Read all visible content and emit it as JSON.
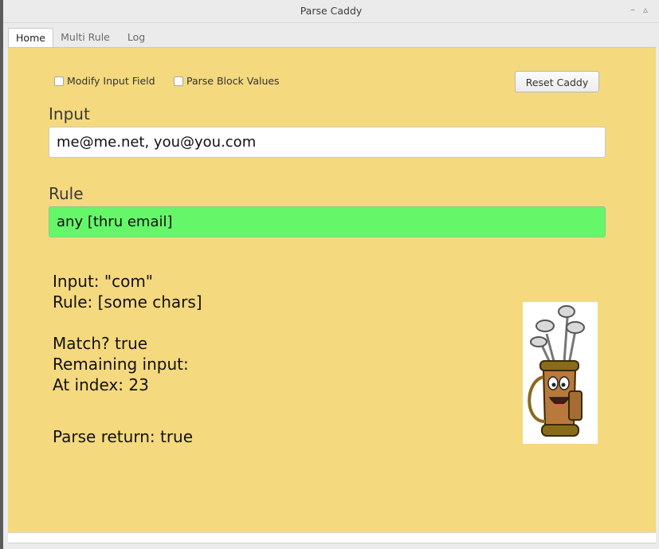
{
  "window": {
    "title": "Parse Caddy"
  },
  "tabs": [
    {
      "label": "Home",
      "active": true
    },
    {
      "label": "Multi Rule",
      "active": false
    },
    {
      "label": "Log",
      "active": false
    }
  ],
  "options": {
    "modify_input_label": "Modify Input Field",
    "modify_input_checked": false,
    "parse_block_label": "Parse Block Values",
    "parse_block_checked": false
  },
  "reset_button": "Reset Caddy",
  "input": {
    "label": "Input",
    "value": "me@me.net, you@you.com"
  },
  "rule": {
    "label": "Rule",
    "value": "any [thru email]"
  },
  "result": {
    "input_line": "Input: \"com\"",
    "rule_line": "Rule: [some chars]",
    "match_line": "Match? true",
    "remaining_line": "Remaining input:",
    "index_line": "At index: 23",
    "parse_return_line": "Parse return: true"
  },
  "colors": {
    "panel_bg": "#f4d97f",
    "rule_ok_bg": "#66f66a"
  },
  "mascot": {
    "icon": "golf-bag-mascot-icon"
  }
}
